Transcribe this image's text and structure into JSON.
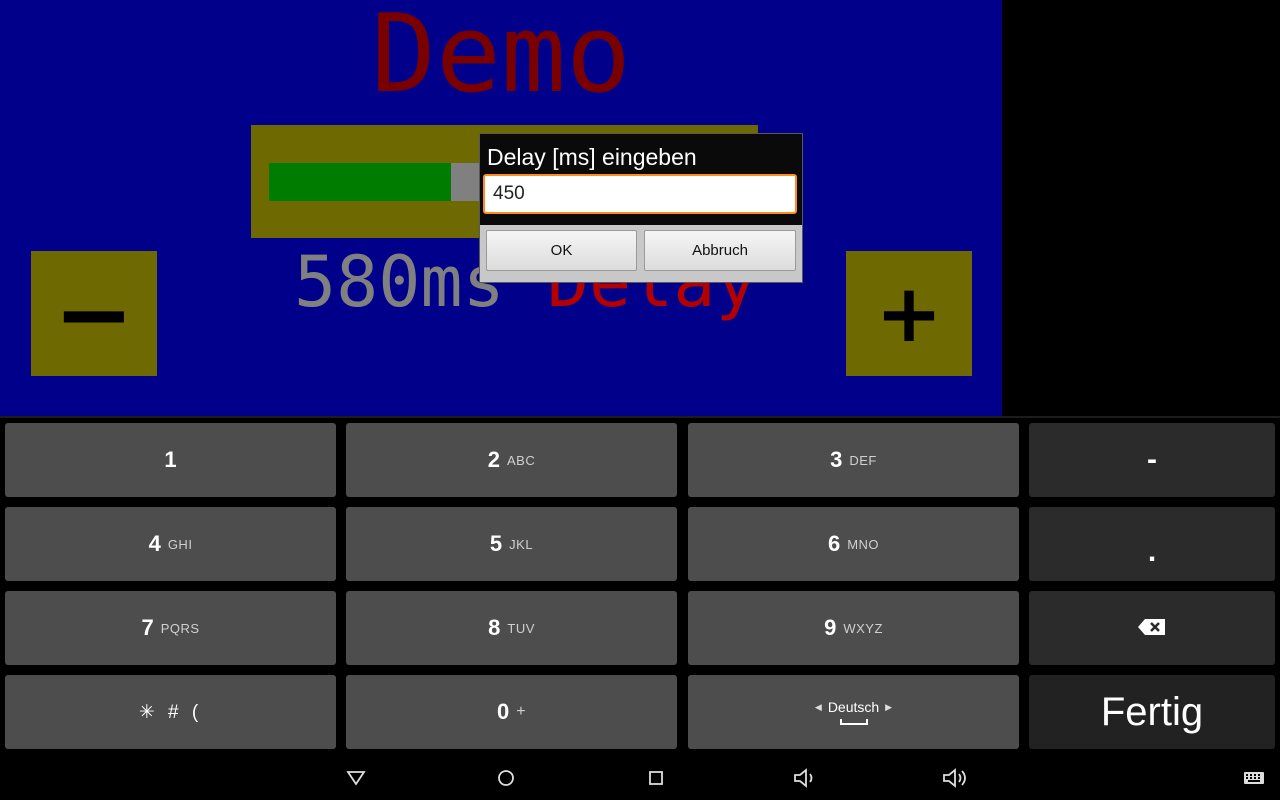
{
  "app": {
    "title": "Demo",
    "progress_fraction": 0.386,
    "delay_value": "580ms",
    "delay_label": " Delay",
    "minus_label": "−",
    "plus_label": "+"
  },
  "dialog": {
    "title": "Delay [ms] eingeben",
    "input_value": "450",
    "ok_label": "OK",
    "cancel_label": "Abbruch"
  },
  "keyboard": {
    "keys": [
      {
        "digit": "1",
        "sub": ""
      },
      {
        "digit": "2",
        "sub": "ABC"
      },
      {
        "digit": "3",
        "sub": "DEF"
      },
      {
        "digit": "4",
        "sub": "GHI"
      },
      {
        "digit": "5",
        "sub": "JKL"
      },
      {
        "digit": "6",
        "sub": "MNO"
      },
      {
        "digit": "7",
        "sub": "PQRS"
      },
      {
        "digit": "8",
        "sub": "TUV"
      },
      {
        "digit": "9",
        "sub": "WXYZ"
      },
      {
        "digit": "0",
        "sub": "+"
      }
    ],
    "symbols_label": "✳ # (",
    "minus_key": "-",
    "dot_key": ".",
    "language": "Deutsch",
    "done_label": "Fertig",
    "backspace_icon": "backspace-icon"
  },
  "navbar": {
    "icons": [
      "back-icon",
      "home-icon",
      "recents-icon",
      "volume-down-icon",
      "volume-up-icon",
      "keyboard-icon"
    ]
  },
  "colors": {
    "app_background": "#00008b",
    "title": "#7a0000",
    "panel": "#6e6900",
    "progress_fill": "#007d00",
    "input_focus_border": "#ff8c1a"
  }
}
